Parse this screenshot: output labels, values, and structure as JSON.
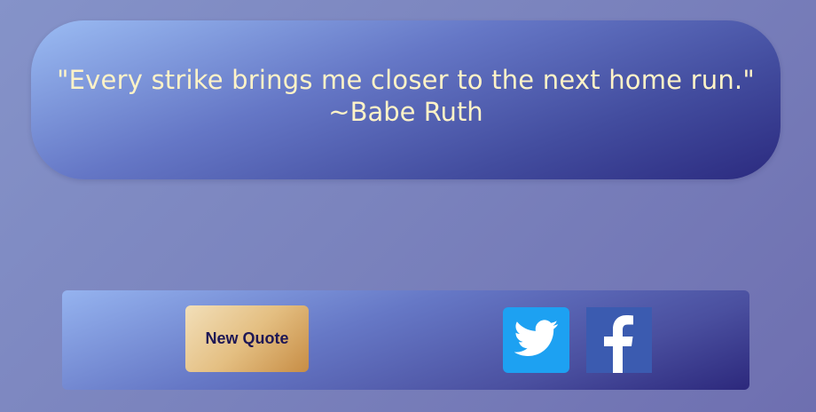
{
  "quote": {
    "text": "\"Every strike brings me closer to the next home run.\"",
    "author": "~Babe Ruth"
  },
  "actions": {
    "new_quote_label": "New Quote",
    "twitter_icon": "twitter-bird-icon",
    "facebook_icon": "facebook-f-icon"
  },
  "colors": {
    "quote_text": "#fff3c7",
    "button_text": "#1e1755",
    "twitter_blue": "#1da1f2",
    "facebook_blue": "#3b5bb0"
  }
}
